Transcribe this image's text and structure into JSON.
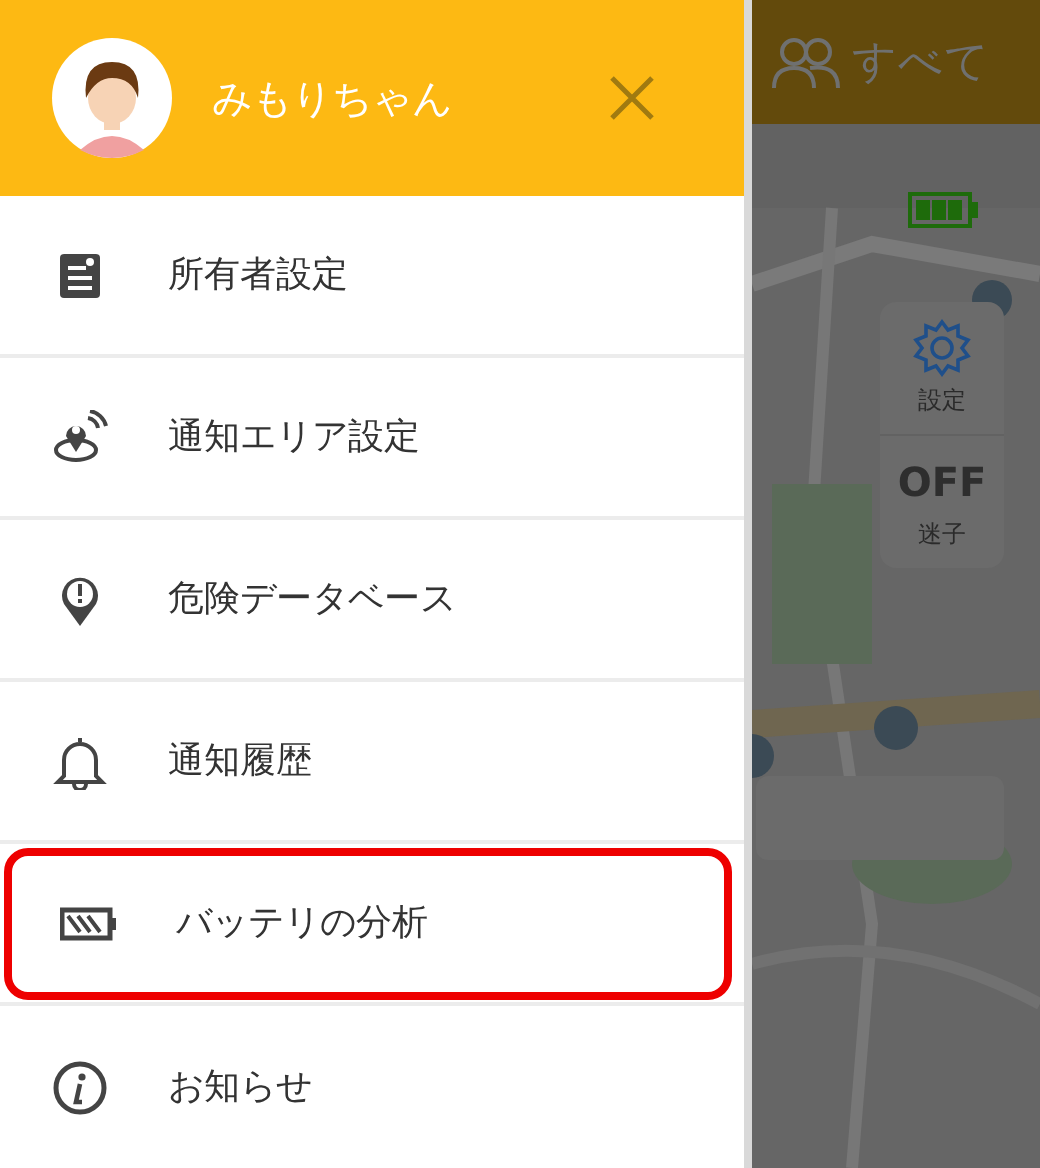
{
  "header": {
    "name": "みもりちゃん"
  },
  "menu": [
    {
      "label": "所有者設定",
      "kind": "owner",
      "highlighted": false
    },
    {
      "label": "通知エリア設定",
      "kind": "area",
      "highlighted": false
    },
    {
      "label": "危険データベース",
      "kind": "danger",
      "highlighted": false
    },
    {
      "label": "通知履歴",
      "kind": "history",
      "highlighted": false
    },
    {
      "label": "バッテリの分析",
      "kind": "battery",
      "highlighted": true
    },
    {
      "label": "お知らせ",
      "kind": "info",
      "highlighted": false
    }
  ],
  "background": {
    "filter": "すべて",
    "map_controls": [
      {
        "kind": "settings",
        "label": "設定"
      },
      {
        "kind": "toggle",
        "badge": "OFF",
        "label": "迷子"
      }
    ]
  }
}
